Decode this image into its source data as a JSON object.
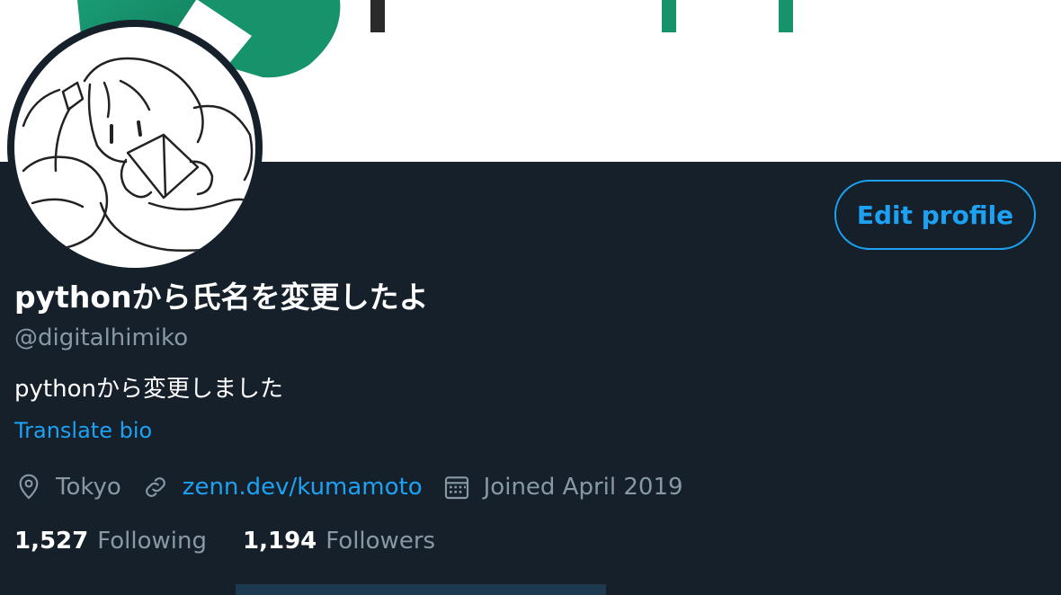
{
  "profile": {
    "display_name": "pythonから氏名を変更したよ",
    "handle": "@digitalhimiko",
    "bio": "pythonから変更しました",
    "translate_label": "Translate bio",
    "edit_button_label": "Edit profile",
    "location": "Tokyo",
    "website": "zenn.dev/kumamoto",
    "joined": "Joined April 2019"
  },
  "stats": {
    "following_count": "1,527",
    "following_label": "Following",
    "followers_count": "1,194",
    "followers_label": "Followers"
  },
  "icons": {
    "location": "location-pin-icon",
    "link": "link-icon",
    "calendar": "calendar-icon"
  },
  "colors": {
    "background": "#15202b",
    "accent": "#1da1f2",
    "secondary_text": "#8899a6",
    "banner_green": "#17936c"
  }
}
